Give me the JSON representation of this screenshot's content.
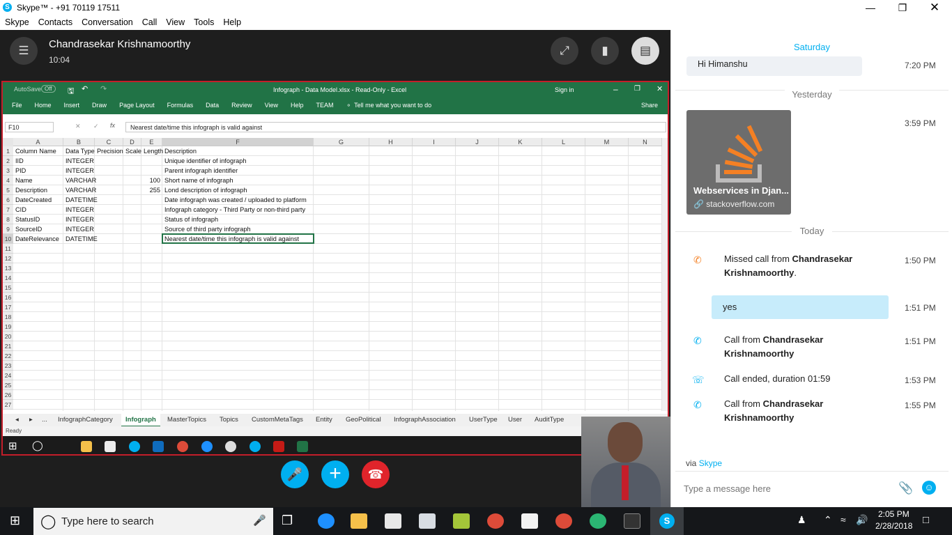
{
  "window": {
    "title": "Skype™ - +91 70119 17511"
  },
  "menu": [
    "Skype",
    "Contacts",
    "Conversation",
    "Call",
    "View",
    "Tools",
    "Help"
  ],
  "call": {
    "contact_name": "Chandrasekar Krishnamoorthy",
    "duration": "10:04"
  },
  "excel": {
    "autosave": "AutoSave",
    "autosave_state": "Off",
    "title": "Infograph - Data Model.xlsx - Read-Only - Excel",
    "signin": "Sign in",
    "ribbon_tabs": [
      "File",
      "Home",
      "Insert",
      "Draw",
      "Page Layout",
      "Formulas",
      "Data",
      "Review",
      "View",
      "Help",
      "TEAM"
    ],
    "tell_me": "Tell me what you want to do",
    "share": "Share",
    "name_box": "F10",
    "formula": "Nearest date/time this infograph is valid against",
    "columns": [
      "A",
      "B",
      "C",
      "D",
      "E",
      "F",
      "G",
      "H",
      "I",
      "J",
      "K",
      "L",
      "M",
      "N"
    ],
    "rows": [
      [
        "Column Name",
        "Data Type",
        "Precision",
        "Scale",
        "Length",
        "Description"
      ],
      [
        "IID",
        "INTEGER",
        "",
        "",
        "",
        "Unique identifier of infograph"
      ],
      [
        "PID",
        "INTEGER",
        "",
        "",
        "",
        "Parent infograph identifier"
      ],
      [
        "Name",
        "VARCHAR",
        "",
        "",
        "100",
        "Short name of infograph"
      ],
      [
        "Description",
        "VARCHAR",
        "",
        "",
        "255",
        "Lond description of infograph"
      ],
      [
        "DateCreated",
        "DATETIME",
        "",
        "",
        "",
        "Date infograph was created / uploaded to platform"
      ],
      [
        "CID",
        "INTEGER",
        "",
        "",
        "",
        "Infograph category - Third Party or non-third party"
      ],
      [
        "StatusID",
        "INTEGER",
        "",
        "",
        "",
        "Status of infograph"
      ],
      [
        "SourceID",
        "INTEGER",
        "",
        "",
        "",
        "Source of third party infograph"
      ],
      [
        "DateRelevance",
        "DATETIME",
        "",
        "",
        "",
        "Nearest date/time this infograph is valid against"
      ]
    ],
    "row_numbers": [
      "1",
      "2",
      "3",
      "4",
      "5",
      "6",
      "7",
      "8",
      "9",
      "10",
      "11",
      "12",
      "13",
      "14",
      "15",
      "16",
      "17",
      "18",
      "19",
      "20",
      "21",
      "22",
      "23",
      "24",
      "25",
      "26",
      "27"
    ],
    "sheet_nav": [
      "◂",
      "▸",
      "..."
    ],
    "sheets": [
      "InfographCategory",
      "Infograph",
      "MasterTopics",
      "Topics",
      "CustomMetaTags",
      "Entity",
      "GeoPolitical",
      "InfographAssociation",
      "UserType",
      "User",
      "AuditType"
    ],
    "active_sheet": "Infograph",
    "status": "Ready"
  },
  "chat": {
    "top_label": "Saturday",
    "messages_prev": [
      {
        "text": "Hi Himanshu",
        "time": "7:20 PM"
      }
    ],
    "yesterday_label": "Yesterday",
    "link_card": {
      "title": "Webservices in Djan...",
      "domain": "stackoverflow.com",
      "time": "3:59 PM"
    },
    "today_label": "Today",
    "events": [
      {
        "type": "missed",
        "pre": "Missed call from ",
        "name": "Chandrasekar Krishnamoorthy",
        "post": ".",
        "time": "1:50 PM"
      },
      {
        "type": "sent",
        "text": "yes",
        "time": "1:51 PM"
      },
      {
        "type": "call",
        "pre": "Call from ",
        "name": "Chandrasekar Krishnamoorthy",
        "post": "",
        "time": "1:51 PM"
      },
      {
        "type": "ended",
        "pre": "Call ended, duration 01:59",
        "name": "",
        "post": "",
        "time": "1:53 PM"
      },
      {
        "type": "call",
        "pre": "Call from ",
        "name": "Chandrasekar Krishnamoorthy",
        "post": "",
        "time": "1:55 PM"
      }
    ],
    "via": "via ",
    "via_link": "Skype",
    "input_placeholder": "Type a message here"
  },
  "taskbar": {
    "search_placeholder": "Type here to search",
    "time": "2:05 PM",
    "date": "2/28/2018"
  },
  "colors": {
    "excel_green": "#217346",
    "skype_blue": "#00aff0",
    "end_call_red": "#e0242b",
    "share_border": "#c41e2a"
  }
}
